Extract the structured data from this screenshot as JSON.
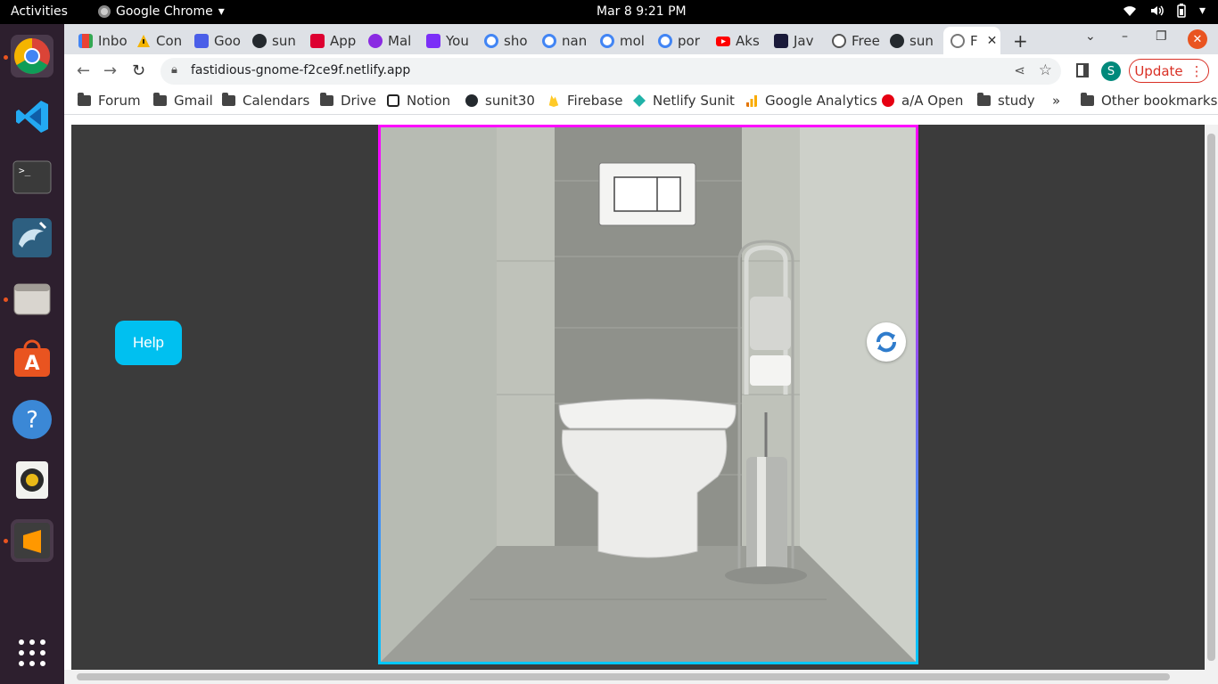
{
  "system": {
    "activities_label": "Activities",
    "app_name": "Google Chrome",
    "app_menu_icon": "chevron-down-icon",
    "clock": "Mar 8  9:21 PM",
    "tray_icons": [
      "wifi-icon",
      "volume-icon",
      "battery-icon",
      "chevron-down-icon"
    ]
  },
  "dock": {
    "items": [
      {
        "name": "google-chrome",
        "icon": "chrome-icon",
        "running": true,
        "active": true
      },
      {
        "name": "visual-studio-code",
        "icon": "vscode-icon",
        "running": false
      },
      {
        "name": "terminal",
        "icon": "terminal-icon",
        "running": false
      },
      {
        "name": "mysql-workbench",
        "icon": "dolphin-icon",
        "running": false
      },
      {
        "name": "files",
        "icon": "folder-icon",
        "running": true
      },
      {
        "name": "ubuntu-software",
        "icon": "software-store-icon",
        "running": false
      },
      {
        "name": "help",
        "icon": "help-icon",
        "running": false
      },
      {
        "name": "rhythmbox",
        "icon": "speaker-icon",
        "running": false
      },
      {
        "name": "sublime-text",
        "icon": "sublime-icon",
        "running": true
      }
    ],
    "show_apps_icon": "grid-icon"
  },
  "tabs": [
    {
      "label": "Inbo",
      "color": "#d93025"
    },
    {
      "label": "Con",
      "color": "#f4b400"
    },
    {
      "label": "Goo",
      "color": "#4a5ee8"
    },
    {
      "label": "sun",
      "color": "#24292e"
    },
    {
      "label": "App",
      "color": "#dd0031"
    },
    {
      "label": "Mal",
      "color": "#8a2be2"
    },
    {
      "label": "You",
      "color": "#7b2ff7"
    },
    {
      "label": "sho",
      "color": "#4285f4"
    },
    {
      "label": "nan",
      "color": "#4285f4"
    },
    {
      "label": "mol",
      "color": "#4285f4"
    },
    {
      "label": "por",
      "color": "#4285f4"
    },
    {
      "label": "Aks",
      "color": "#ff0000"
    },
    {
      "label": "Jav",
      "color": "#1a1a3a"
    },
    {
      "label": "Free",
      "color": "#555555"
    },
    {
      "label": "sun",
      "color": "#24292e"
    },
    {
      "label": "F",
      "color": "#777777",
      "active": true
    }
  ],
  "toolbar": {
    "url": "fastidious-gnome-f2ce9f.netlify.app",
    "profile_initial": "S",
    "update_label": "Update",
    "profile_color": "#00897b",
    "update_color": "#d93025"
  },
  "bookmarks": {
    "items": [
      {
        "label": "Forum",
        "icon": "folder-icon"
      },
      {
        "label": "Gmail",
        "icon": "folder-icon"
      },
      {
        "label": "Calendars",
        "icon": "folder-icon"
      },
      {
        "label": "Drive",
        "icon": "folder-icon"
      },
      {
        "label": "Notion",
        "icon": "notion-icon"
      },
      {
        "label": "sunit30",
        "icon": "github-icon"
      },
      {
        "label": "Firebase",
        "icon": "firebase-icon"
      },
      {
        "label": "Netlify Sunit",
        "icon": "netlify-icon"
      },
      {
        "label": "Google Analytics",
        "icon": "analytics-icon"
      },
      {
        "label": "a/A Open",
        "icon": "appacademy-icon"
      },
      {
        "label": "study",
        "icon": "folder-icon"
      }
    ],
    "overflow": "»",
    "other": "Other bookmarks"
  },
  "page": {
    "help_label": "Help",
    "refresh_icon": "refresh-icon",
    "help_color": "#00c0f0",
    "frame_gradient": [
      "#ff00ff",
      "#00c8ff"
    ],
    "background": "#3b3b3b"
  }
}
